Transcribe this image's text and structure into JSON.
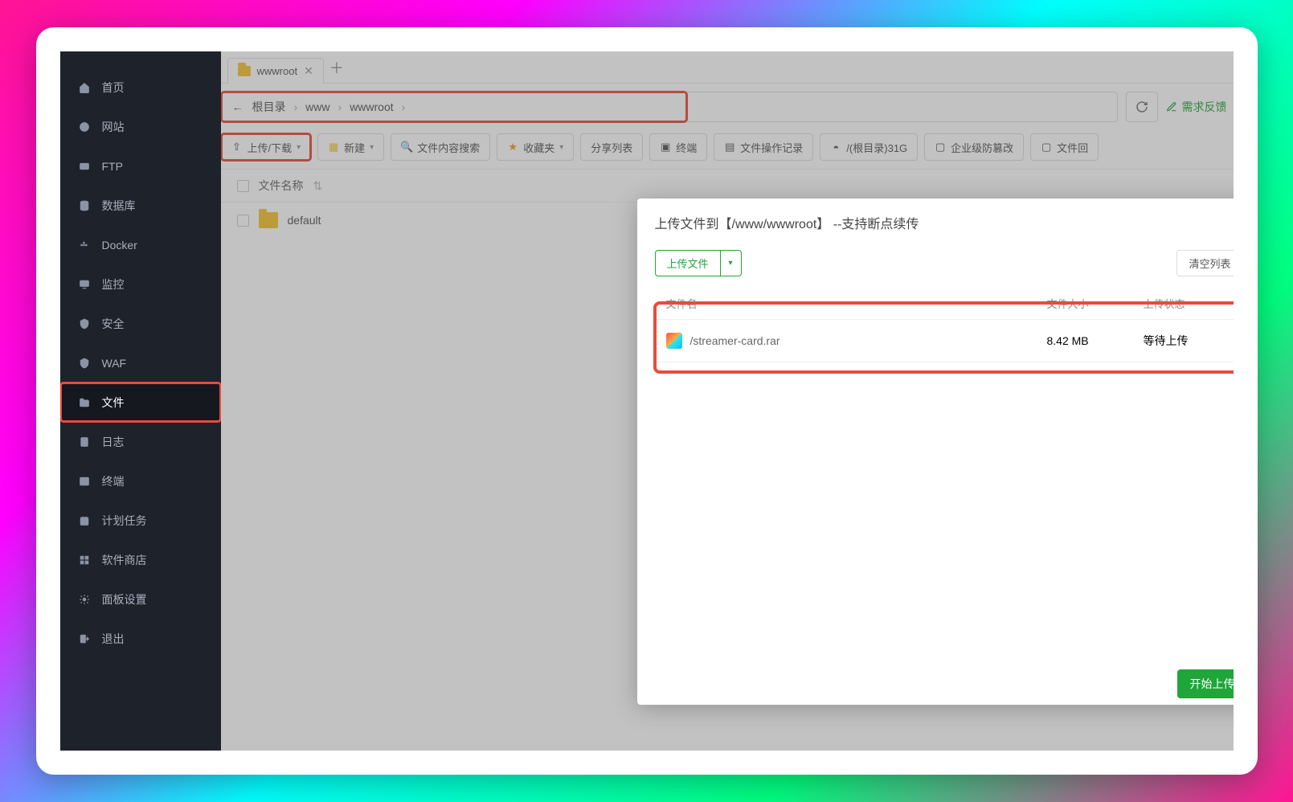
{
  "sidebar": {
    "items": [
      {
        "label": "首页"
      },
      {
        "label": "网站"
      },
      {
        "label": "FTP"
      },
      {
        "label": "数据库"
      },
      {
        "label": "Docker"
      },
      {
        "label": "监控"
      },
      {
        "label": "安全"
      },
      {
        "label": "WAF"
      },
      {
        "label": "文件"
      },
      {
        "label": "日志"
      },
      {
        "label": "终端"
      },
      {
        "label": "计划任务"
      },
      {
        "label": "软件商店"
      },
      {
        "label": "面板设置"
      },
      {
        "label": "退出"
      }
    ]
  },
  "tab": {
    "label": "wwwroot"
  },
  "breadcrumb": {
    "root": "根目录",
    "parts": [
      "www",
      "wwwroot"
    ]
  },
  "feedback": "需求反馈",
  "toolbar": {
    "upload": "上传/下载",
    "new": "新建",
    "search": "文件内容搜索",
    "fav": "收藏夹",
    "share": "分享列表",
    "terminal": "终端",
    "ops": "文件操作记录",
    "disk": "/(根目录)31G",
    "tamper": "企业级防篡改",
    "recycle": "文件回"
  },
  "list": {
    "header": "文件名称",
    "row": "default"
  },
  "modal": {
    "title": "上传文件到【/www/wwwroot】 --支持断点续传",
    "upload_btn": "上传文件",
    "clear_btn": "清空列表",
    "col_name": "文件名",
    "col_size": "文件大小",
    "col_status": "上传状态",
    "file_name": "/streamer-card.rar",
    "file_size": "8.42 MB",
    "file_status": "等待上传",
    "start": "开始上传"
  }
}
